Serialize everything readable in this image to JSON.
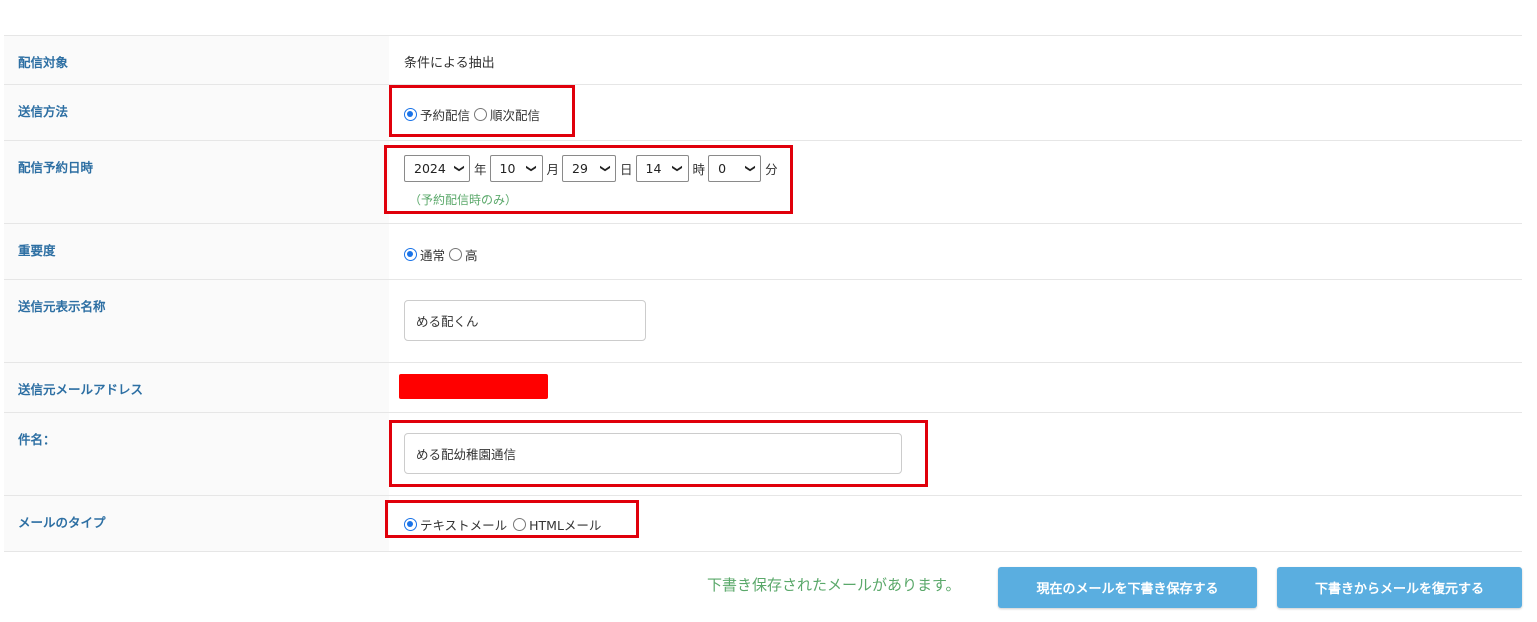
{
  "form": {
    "delivery_target": {
      "label": "配信対象",
      "value": "条件による抽出"
    },
    "send_method": {
      "label": "送信方法",
      "options": [
        "予約配信",
        "順次配信"
      ],
      "selected": "予約配信"
    },
    "schedule": {
      "label": "配信予約日時",
      "year": "2024",
      "year_unit": "年",
      "month": "10",
      "month_unit": "月",
      "day": "29",
      "day_unit": "日",
      "hour": "14",
      "hour_unit": "時",
      "minute": "0",
      "minute_unit": "分",
      "note": "（予約配信時のみ）"
    },
    "importance": {
      "label": "重要度",
      "options": [
        "通常",
        "高"
      ],
      "selected": "通常"
    },
    "sender_name": {
      "label": "送信元表示名称",
      "value": "める配くん"
    },
    "sender_address": {
      "label": "送信元メールアドレス"
    },
    "subject": {
      "label": "件名：",
      "value": "める配幼稚園通信"
    },
    "mail_type": {
      "label": "メールのタイプ",
      "options": [
        "テキストメール",
        "HTMLメール"
      ],
      "selected": "テキストメール"
    }
  },
  "footer": {
    "draft_message": "下書き保存されたメールがあります。",
    "save_draft_button": "現在のメールを下書き保存する",
    "restore_draft_button": "下書きからメールを復元する"
  },
  "colors": {
    "label": "#2d6fa3",
    "button": "#5aaee0",
    "note": "#5aa86a",
    "highlight": "#e0000b",
    "radio": "#1a73e8"
  }
}
